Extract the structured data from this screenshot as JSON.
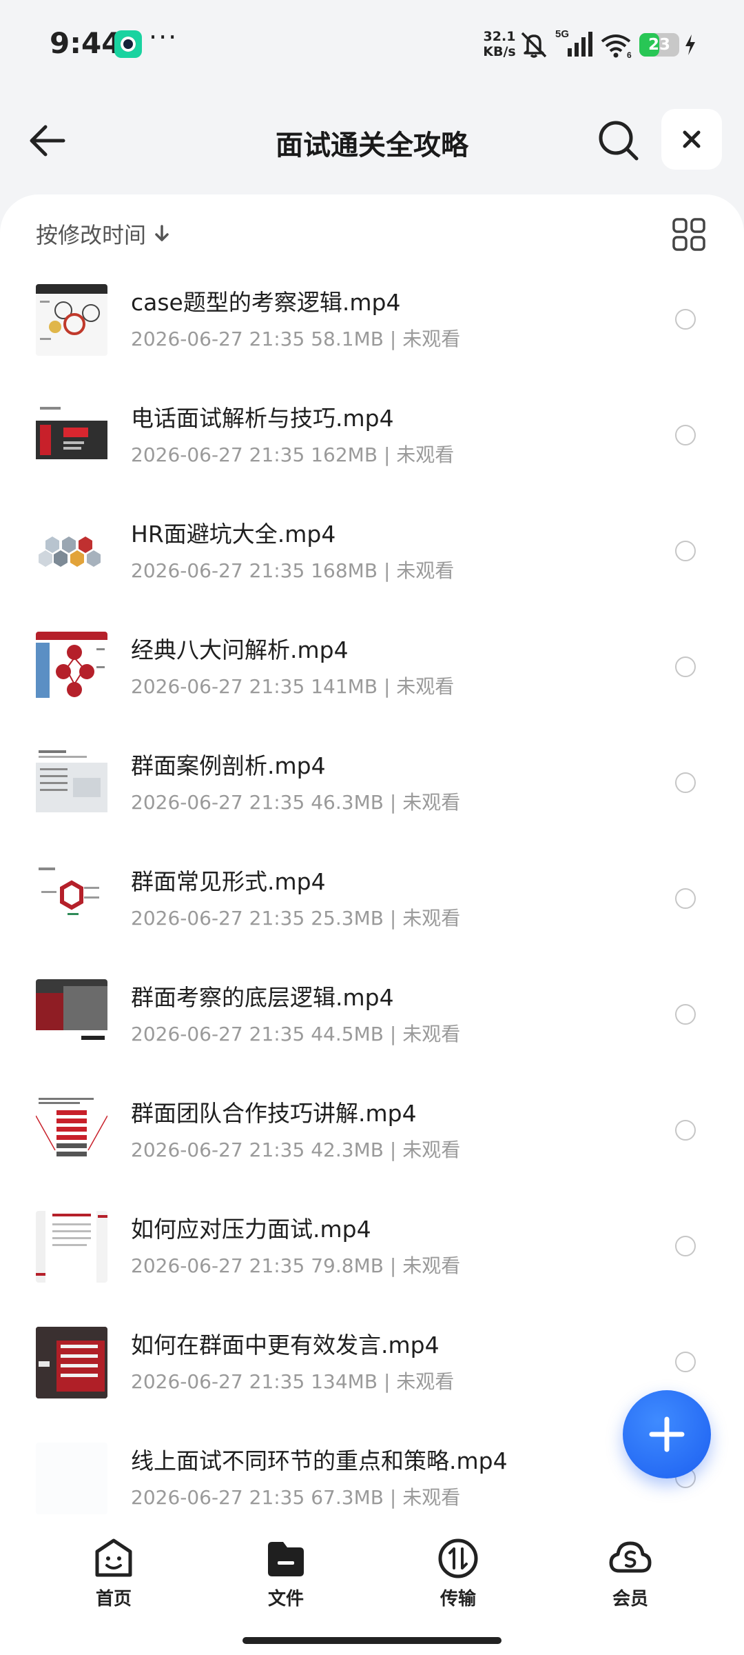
{
  "status_bar": {
    "time": "9:44",
    "dots": "···",
    "net_speed_value": "32.1",
    "net_speed_unit": "KB/s",
    "network": "5G",
    "wifi_band": "6",
    "battery": "23",
    "battery_level_percent": 23
  },
  "header": {
    "title": "面试通关全攻略"
  },
  "sort": {
    "label": "按修改时间"
  },
  "files": [
    {
      "name": "case题型的考察逻辑.mp4",
      "date": "2026-06-27 21:35",
      "size": "58.1MB",
      "status": "未观看"
    },
    {
      "name": "电话面试解析与技巧.mp4",
      "date": "2026-06-27 21:35",
      "size": "162MB",
      "status": "未观看"
    },
    {
      "name": "HR面避坑大全.mp4",
      "date": "2026-06-27 21:35",
      "size": "168MB",
      "status": "未观看"
    },
    {
      "name": "经典八大问解析.mp4",
      "date": "2026-06-27 21:35",
      "size": "141MB",
      "status": "未观看"
    },
    {
      "name": "群面案例剖析.mp4",
      "date": "2026-06-27 21:35",
      "size": "46.3MB",
      "status": "未观看"
    },
    {
      "name": "群面常见形式.mp4",
      "date": "2026-06-27 21:35",
      "size": "25.3MB",
      "status": "未观看"
    },
    {
      "name": "群面考察的底层逻辑.mp4",
      "date": "2026-06-27 21:35",
      "size": "44.5MB",
      "status": "未观看"
    },
    {
      "name": "群面团队合作技巧讲解.mp4",
      "date": "2026-06-27 21:35",
      "size": "42.3MB",
      "status": "未观看"
    },
    {
      "name": "如何应对压力面试.mp4",
      "date": "2026-06-27 21:35",
      "size": "79.8MB",
      "status": "未观看"
    },
    {
      "name": "如何在群面中更有效发言.mp4",
      "date": "2026-06-27 21:35",
      "size": "134MB",
      "status": "未观看"
    },
    {
      "name": "线上面试不同环节的重点和策略.mp4",
      "date": "2026-06-27 21:35",
      "size": "67.3MB",
      "status": "未观看"
    }
  ],
  "nav": {
    "home": "首页",
    "files": "文件",
    "transfer": "传输",
    "member": "会员"
  },
  "colors": {
    "accent": "#1c5ff0",
    "battery": "#28c655",
    "meta_text": "#9a9a9a"
  }
}
